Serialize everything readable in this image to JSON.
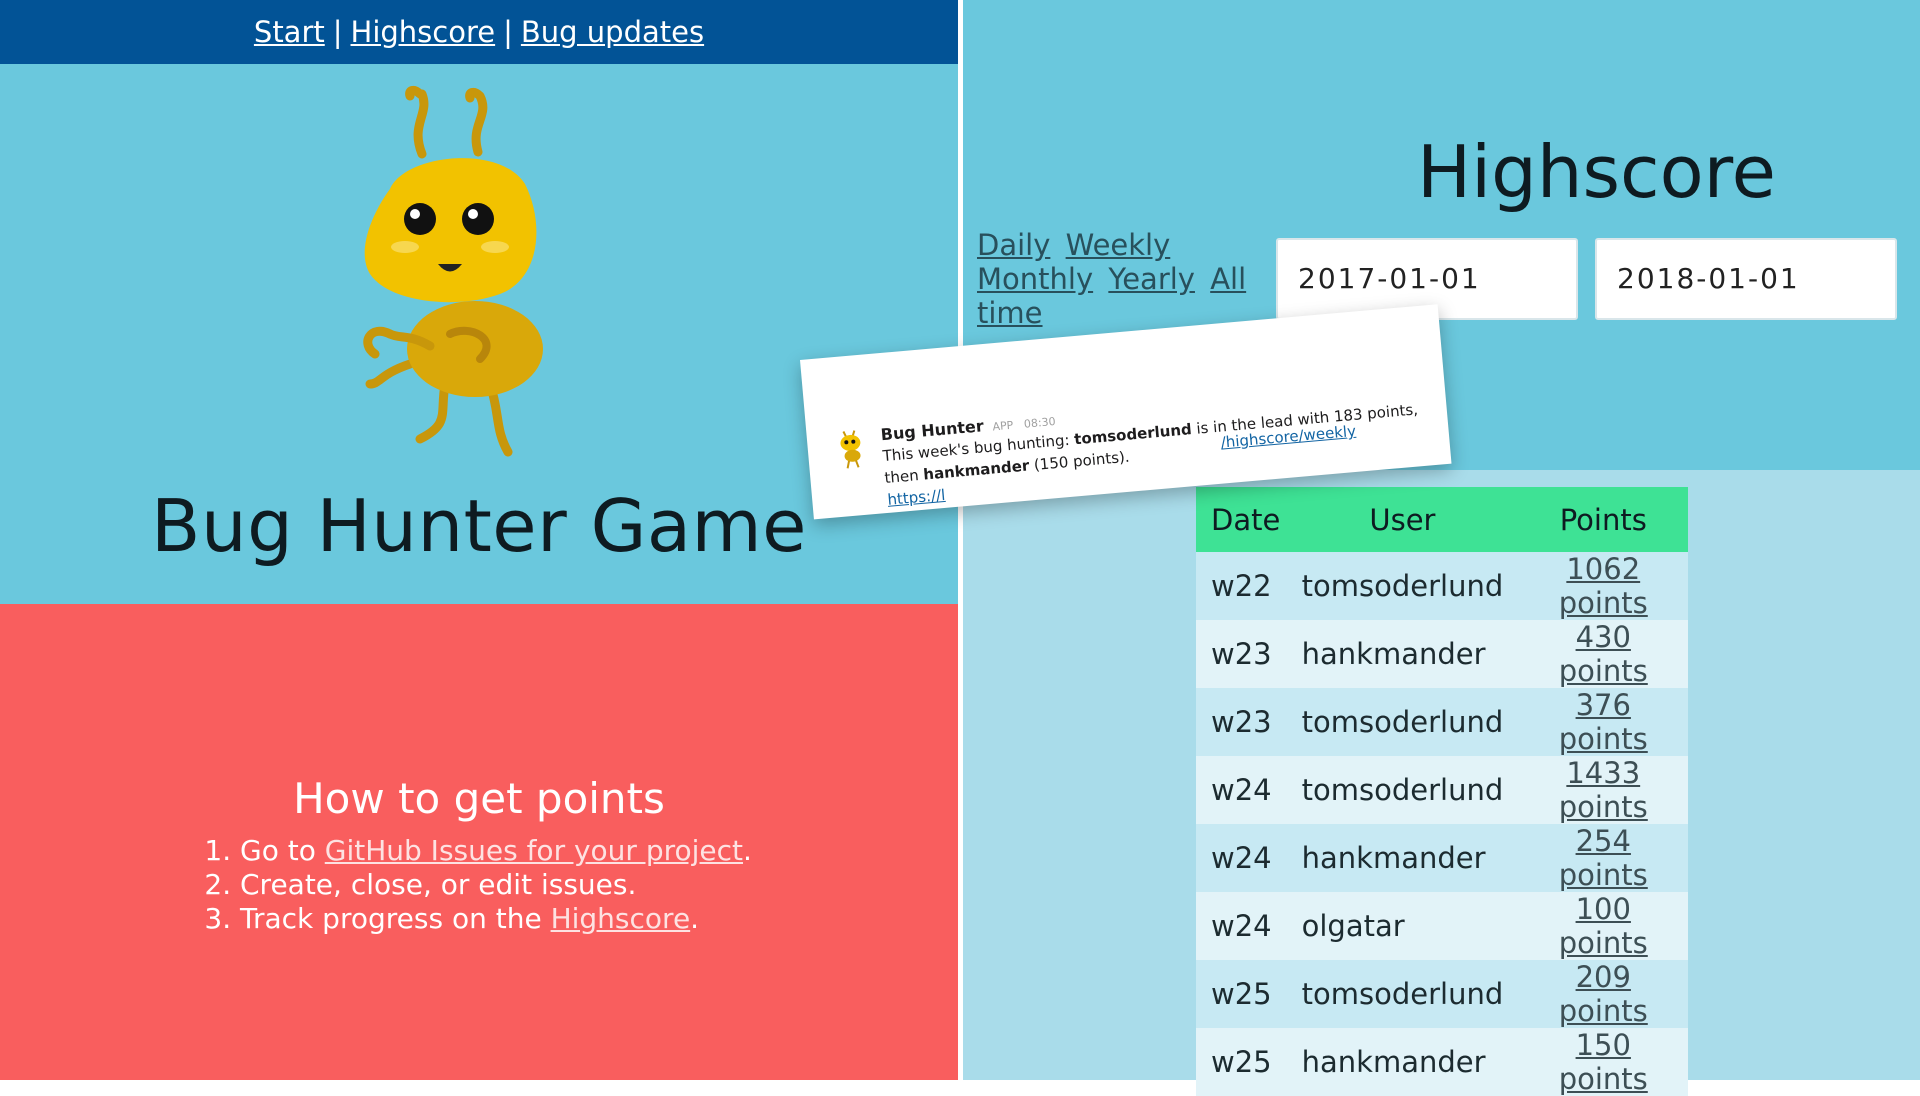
{
  "nav": {
    "links": [
      "Start",
      "Highscore",
      "Bug updates"
    ],
    "separator": "|"
  },
  "hero": {
    "title": "Bug Hunter Game",
    "mascot_icon": "ant-mascot-icon"
  },
  "howto": {
    "heading": "How to get points",
    "step1_prefix": "Go to ",
    "step1_link": "GitHub Issues for your project",
    "step1_suffix": ".",
    "step2": "Create, close, or edit issues.",
    "step3_prefix": "Track progress on the ",
    "step3_link": "Highscore",
    "step3_suffix": "."
  },
  "highscore": {
    "title": "Highscore",
    "periods": [
      "Daily",
      "Weekly",
      "Monthly",
      "Yearly",
      "All time"
    ],
    "date_from": "2017-01-01",
    "date_to": "2018-01-01",
    "columns": [
      "Date",
      "User",
      "Points"
    ],
    "rows": [
      {
        "date": "w22",
        "user": "tomsoderlund",
        "points": "1062 points"
      },
      {
        "date": "w23",
        "user": "hankmander",
        "points": "430 points"
      },
      {
        "date": "w23",
        "user": "tomsoderlund",
        "points": "376 points"
      },
      {
        "date": "w24",
        "user": "tomsoderlund",
        "points": "1433 points"
      },
      {
        "date": "w24",
        "user": "hankmander",
        "points": "254 points"
      },
      {
        "date": "w24",
        "user": "olgatar",
        "points": "100 points"
      },
      {
        "date": "w25",
        "user": "tomsoderlund",
        "points": "209 points"
      },
      {
        "date": "w25",
        "user": "hankmander",
        "points": "150 points"
      }
    ]
  },
  "slack": {
    "app_name": "Bug Hunter",
    "app_badge": "APP",
    "time": "08:30",
    "msg_prefix": "This week's bug hunting: ",
    "leader": "tomsoderlund",
    "msg_middle": " is in the lead with 183 points, then ",
    "second": "hankmander",
    "msg_suffix": " (150 points).",
    "link_start": "https://l",
    "link_end": "/highscore/weekly"
  },
  "colors": {
    "nav_bg": "#025396",
    "hero_bg": "#6ac8dd",
    "howto_bg": "#f95e5e",
    "table_header": "#3ee295",
    "mascot_yellow": "#f2c200"
  }
}
